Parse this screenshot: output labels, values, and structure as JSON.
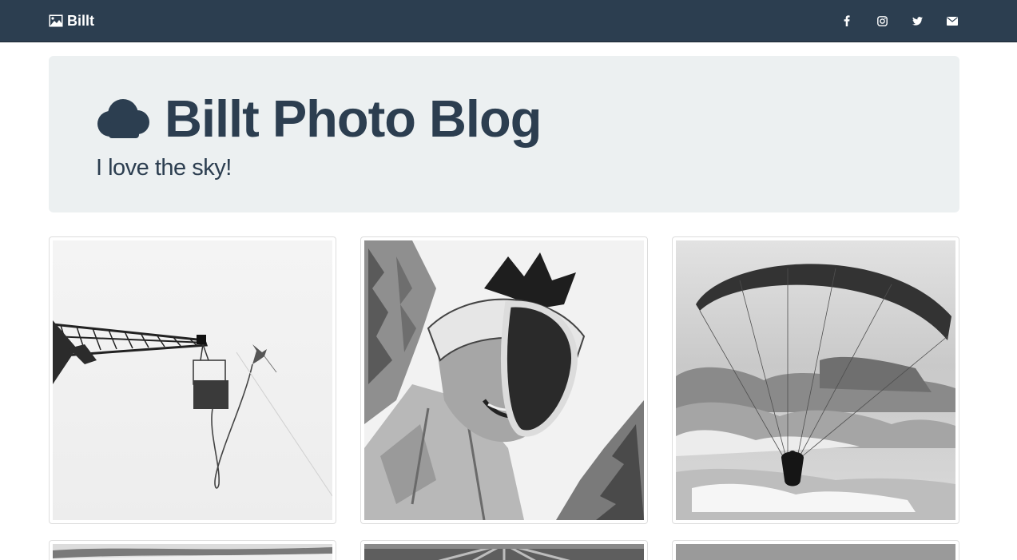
{
  "navbar": {
    "brand_label": "Billt",
    "social": [
      {
        "icon": "facebook-icon"
      },
      {
        "icon": "instagram-icon"
      },
      {
        "icon": "twitter-icon"
      },
      {
        "icon": "envelope-icon"
      }
    ]
  },
  "jumbotron": {
    "title": "Billt Photo Blog",
    "subtitle": "I love the sky!",
    "icon": "cloud-icon"
  },
  "colors": {
    "navbar_bg": "#2c3e50",
    "jumbotron_bg": "#ecf0f1",
    "text_primary": "#2c3e50"
  },
  "gallery": {
    "photos": [
      {
        "subject": "crane-bungee-jump"
      },
      {
        "subject": "skier-goggles-selfie"
      },
      {
        "subject": "paraglider-in-sky"
      },
      {
        "subject": "snowy-landscape"
      },
      {
        "subject": "light-rays"
      },
      {
        "subject": "grey-horizon"
      }
    ]
  }
}
